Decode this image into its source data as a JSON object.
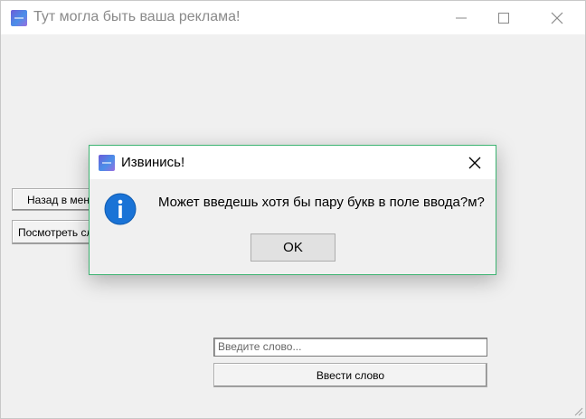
{
  "main_window": {
    "title": "Тут могла быть ваша реклама!",
    "icon": "app-icon",
    "controls": [
      "minimize-icon",
      "maximize-icon",
      "close-icon"
    ]
  },
  "sidebar": {
    "back_button": "Назад в меню",
    "view_button": "Посмотреть слова"
  },
  "word_entry": {
    "placeholder": "Введите слово...",
    "submit_label": "Ввести слово"
  },
  "dialog": {
    "title": "Извинись!",
    "icon": "info-icon",
    "message": "Может введешь хотя бы пару букв в поле ввода?м?",
    "ok_label": "OK",
    "accent_color": "#3cb371"
  }
}
